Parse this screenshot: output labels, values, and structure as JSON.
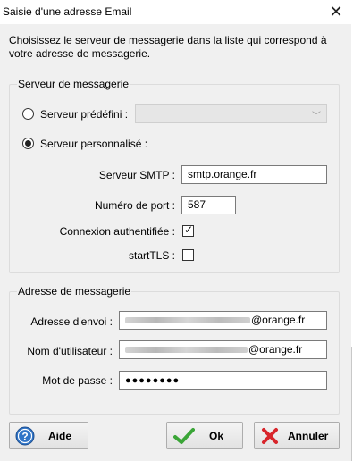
{
  "window": {
    "title": "Saisie d'une adresse Email"
  },
  "intro_text": "Choisissez le serveur de messagerie dans la liste qui correspond à votre adresse de messagerie.",
  "server_group": {
    "title": "Serveur de messagerie",
    "predefined_label": "Serveur prédéfini :",
    "predefined_selected": "",
    "custom_label": "Serveur personnalisé :",
    "smtp_label": "Serveur SMTP :",
    "smtp_value": "smtp.orange.fr",
    "port_label": "Numéro de port :",
    "port_value": "587",
    "auth_label": "Connexion authentifiée :",
    "auth_checked": true,
    "starttls_label": "startTLS :",
    "starttls_checked": false
  },
  "address_group": {
    "title": "Adresse de messagerie",
    "sender_label": "Adresse d'envoi :",
    "sender_suffix": "@orange.fr",
    "username_label": "Nom d'utilisateur :",
    "username_suffix": "@orange.fr",
    "password_label": "Mot de passe :",
    "password_dots": "●●●●●●●●"
  },
  "buttons": {
    "help": "Aide",
    "ok": "Ok",
    "cancel": "Annuler"
  },
  "colors": {
    "help_icon": "#2f74c7",
    "ok_icon": "#3aa537",
    "cancel_icon": "#d8252b"
  }
}
